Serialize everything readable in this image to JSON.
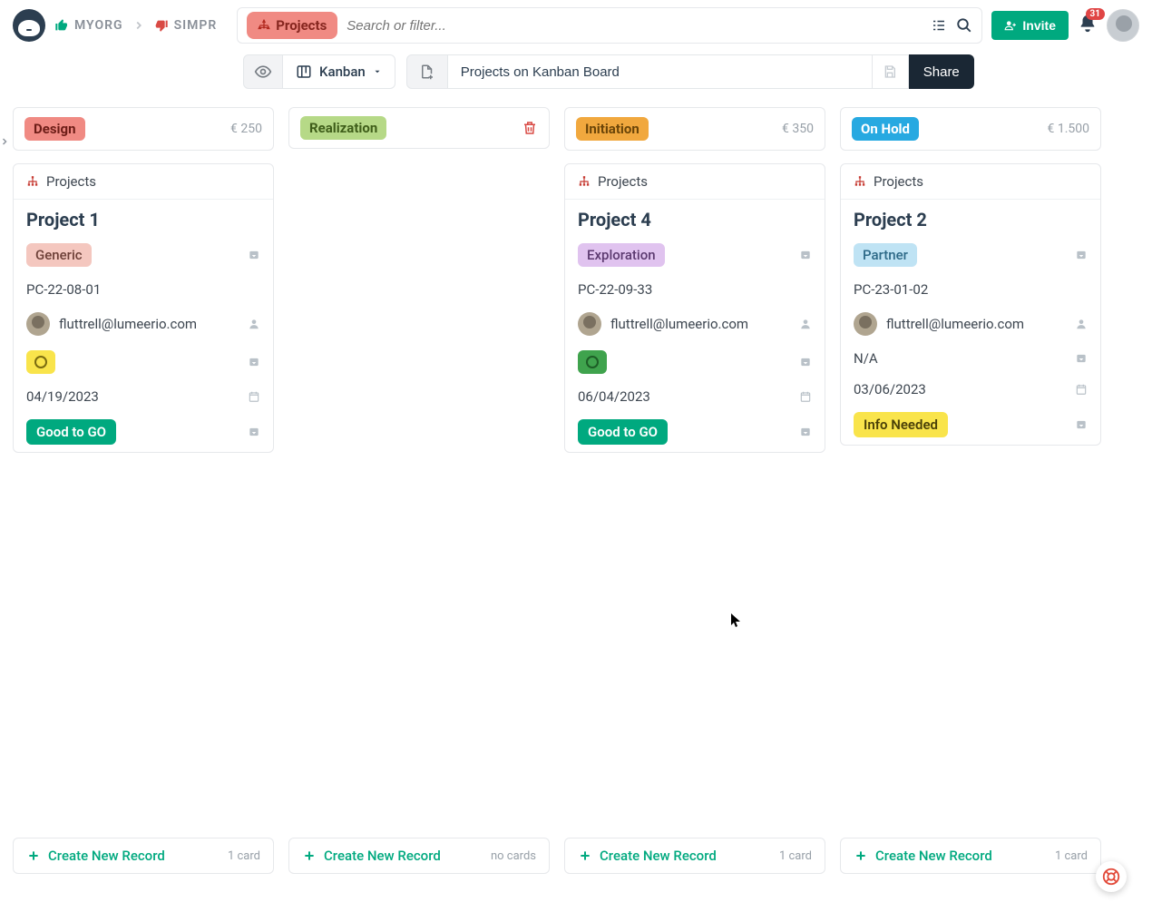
{
  "breadcrumb": {
    "org": "MYORG",
    "project": "SIMPR"
  },
  "search": {
    "projectsChipLabel": "Projects",
    "placeholder": "Search or filter..."
  },
  "inviteLabel": "Invite",
  "notificationCount": "31",
  "view": {
    "typeLabel": "Kanban",
    "boardName": "Projects on Kanban Board",
    "shareLabel": "Share"
  },
  "columns": [
    {
      "label": "Design",
      "labelBg": "#f08a83",
      "labelFg": "#6d1d17",
      "amount": "€ 250",
      "cardsCollection": "Projects",
      "card": {
        "title": "Project 1",
        "tag": "Generic",
        "tagBg": "#f4c7bf",
        "tagFg": "#6d4038",
        "code": "PC-22-08-01",
        "userEmail": "fluttrell@lumeerio.com",
        "statusChipBg": "#f9e44b",
        "statusCircleBorder": "#7a6b10",
        "date": "04/19/2023",
        "go": "Good to GO",
        "goBg": "#00a97f"
      },
      "footerCount": "1 card"
    },
    {
      "label": "Realization",
      "labelBg": "#b6d987",
      "labelFg": "#3f5e1a",
      "amount": "",
      "cardsCollection": "",
      "card": null,
      "footerCount": "no cards"
    },
    {
      "label": "Initiation",
      "labelBg": "#f1a83e",
      "labelFg": "#6b4508",
      "amount": "€ 350",
      "cardsCollection": "Projects",
      "card": {
        "title": "Project 4",
        "tag": "Exploration",
        "tagBg": "#e0c3ef",
        "tagFg": "#5c3a70",
        "code": "PC-22-09-33",
        "userEmail": "fluttrell@lumeerio.com",
        "statusChipBg": "#3fa34d",
        "statusCircleBorder": "#1d5d26",
        "date": "06/04/2023",
        "go": "Good to GO",
        "goBg": "#00a97f"
      },
      "footerCount": "1 card"
    },
    {
      "label": "On Hold",
      "labelBg": "#27a9e1",
      "labelFg": "#ffffff",
      "amount": "€ 1.500",
      "cardsCollection": "Projects",
      "card": {
        "title": "Project 2",
        "tag": "Partner",
        "tagBg": "#bfe3f4",
        "tagFg": "#2d6987",
        "code": "PC-23-01-02",
        "userEmail": "fluttrell@lumeerio.com",
        "statusText": "N/A",
        "date": "03/06/2023",
        "go": "Info Needed",
        "goBg": "#f9e44b",
        "goFg": "#4a4008"
      },
      "footerCount": "1 card"
    }
  ],
  "createLabel": "Create New Record"
}
